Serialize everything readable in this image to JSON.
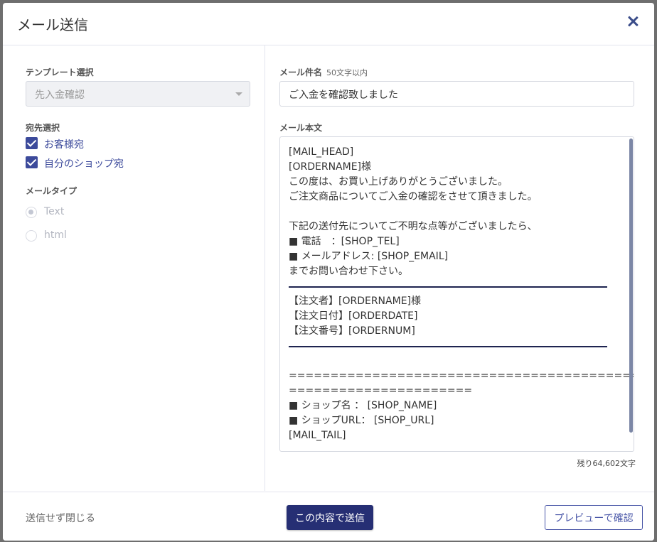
{
  "modal": {
    "title": "メール送信"
  },
  "left": {
    "template_label": "テンプレート選択",
    "template_value": "先入金確認",
    "recipient_label": "宛先選択",
    "recipients": [
      "お客様宛",
      "自分のショップ宛"
    ],
    "mailtype_label": "メールタイプ",
    "mailtypes": [
      "Text",
      "html"
    ],
    "mailtype_selected": "Text"
  },
  "right": {
    "subject_label": "メール件名",
    "subject_hint": "50文字以内",
    "subject_value": "ご入金を確認致しました",
    "body_label": "メール本文",
    "body_lines": [
      "[MAIL_HEAD]",
      "[ORDERNAME]様",
      "この度は、お買い上げありがとうございました。",
      "ご注文商品についてご入金の確認をさせて頂きました。",
      "",
      "下記の送付先についてご不明な点等がございましたら、",
      "■ 電話　：[SHOP_TEL]",
      "■ メールアドレス: [SHOP_EMAIL]",
      "までお問い合わせ下さい。",
      "【注文者】[ORDERNAME]様",
      "【注文日付】[ORDERDATE]",
      "【注文番号】[ORDERNUM]",
      "==========================================",
      "======================",
      "■ ショップ名 ： [SHOP_NAME]",
      "■ ショップURL： [SHOP_URL]",
      "[MAIL_TAIL]"
    ],
    "remaining": "残り64,602文字"
  },
  "footer": {
    "cancel_label": "送信せず閉じる",
    "send_label": "この内容で送信",
    "preview_label": "プレビューで確認"
  },
  "colors": {
    "primary": "#262f74",
    "accent": "#3c4a9b",
    "outline": "#4a57a8"
  },
  "icons": {
    "close": "close-icon",
    "select": "chevron-down-icon"
  }
}
